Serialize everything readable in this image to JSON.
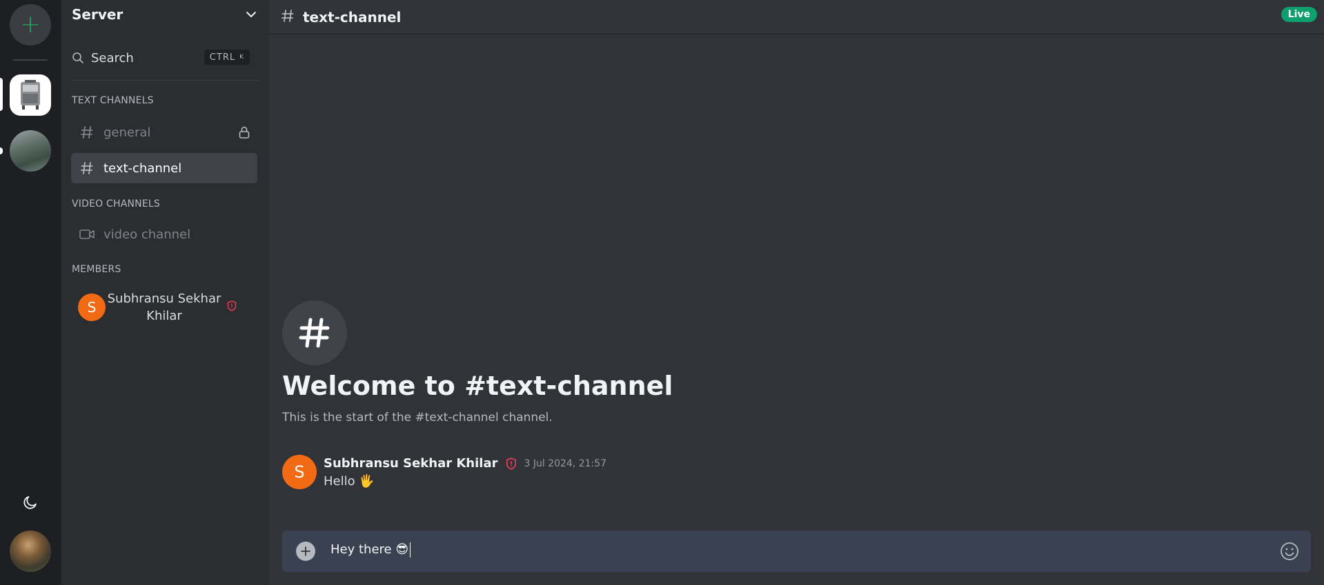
{
  "server_header": {
    "name": "Server"
  },
  "search": {
    "label": "Search",
    "shortcut_mod": "CTRL",
    "shortcut_key": "K"
  },
  "sections": {
    "text": "TEXT CHANNELS",
    "video": "VIDEO CHANNELS",
    "members": "MEMBERS"
  },
  "channels": [
    {
      "name": "general",
      "type": "text",
      "locked": true,
      "active": false
    },
    {
      "name": "text-channel",
      "type": "text",
      "locked": false,
      "active": true
    },
    {
      "name": "video channel",
      "type": "video",
      "locked": false,
      "active": false
    }
  ],
  "members": [
    {
      "initial": "S",
      "name": "Subhransu Sekhar Khilar",
      "role_icon": "shield-alert-icon"
    }
  ],
  "topbar": {
    "channel": "text-channel",
    "status": "Live"
  },
  "welcome": {
    "title": "Welcome to #text-channel",
    "subtitle": "This is the start of the #text-channel channel."
  },
  "messages": [
    {
      "initial": "S",
      "author": "Subhransu Sekhar Khilar",
      "timestamp": "3 Jul 2024, 21:57",
      "text": "Hello 🖐"
    }
  ],
  "composer": {
    "value": "Hey there 😎"
  },
  "colors": {
    "accent_green": "#23a55a",
    "live_badge": "#0e9f6e",
    "avatar_orange": "#f26a14",
    "admin_shield": "#f23f5d"
  }
}
